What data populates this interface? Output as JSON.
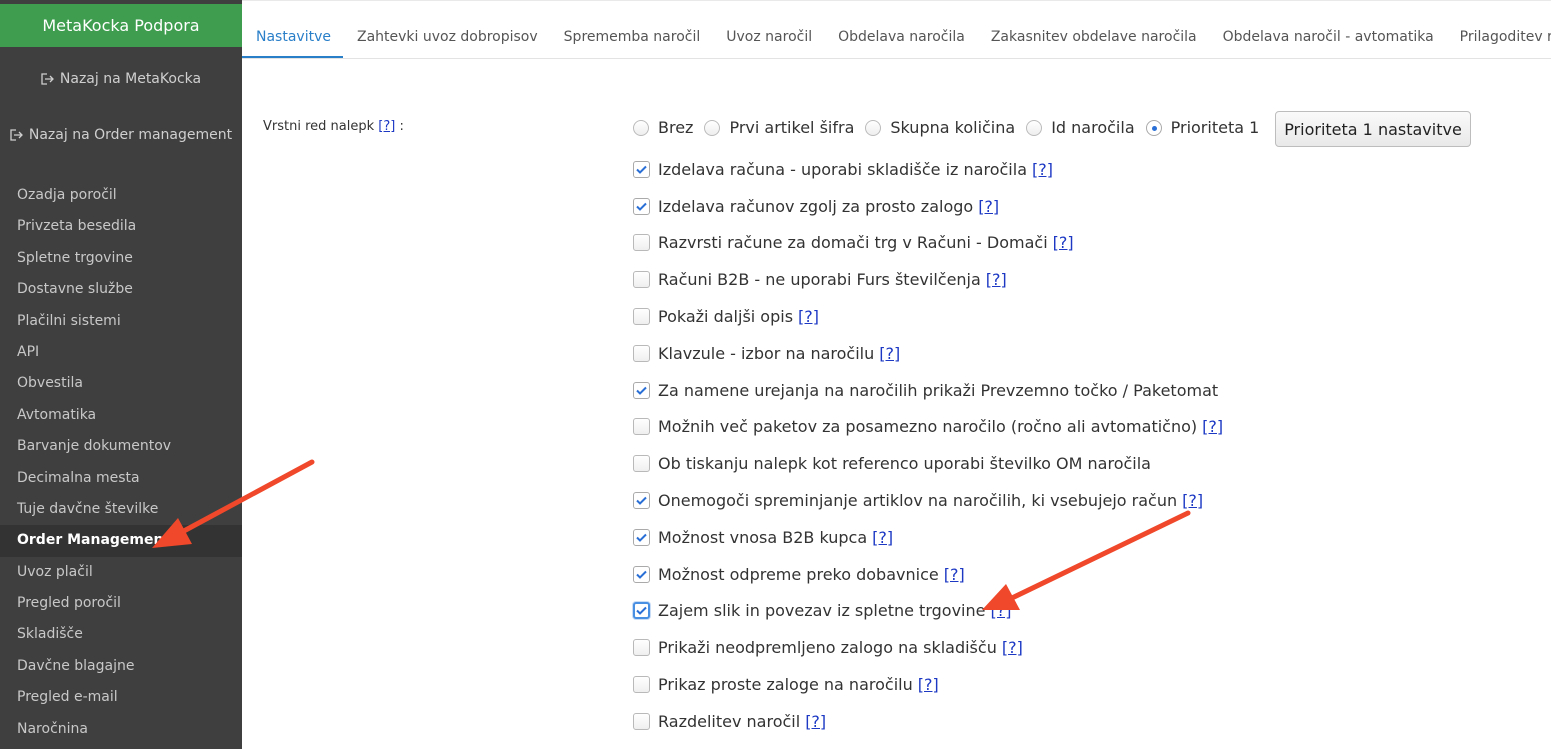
{
  "sidebar": {
    "brand": "MetaKocka Podpora",
    "back_links": [
      "Nazaj na MetaKocka",
      "Nazaj na Order management"
    ],
    "items": [
      {
        "label": "Ozadja poročil",
        "active": false
      },
      {
        "label": "Privzeta besedila",
        "active": false
      },
      {
        "label": "Spletne trgovine",
        "active": false
      },
      {
        "label": "Dostavne službe",
        "active": false
      },
      {
        "label": "Plačilni sistemi",
        "active": false
      },
      {
        "label": "API",
        "active": false
      },
      {
        "label": "Obvestila",
        "active": false
      },
      {
        "label": "Avtomatika",
        "active": false
      },
      {
        "label": "Barvanje dokumentov",
        "active": false
      },
      {
        "label": "Decimalna mesta",
        "active": false
      },
      {
        "label": "Tuje davčne številke",
        "active": false
      },
      {
        "label": "Order Management",
        "active": true
      },
      {
        "label": "Uvoz plačil",
        "active": false
      },
      {
        "label": "Pregled poročil",
        "active": false
      },
      {
        "label": "Skladišče",
        "active": false
      },
      {
        "label": "Davčne blagajne",
        "active": false
      },
      {
        "label": "Pregled e-mail",
        "active": false
      },
      {
        "label": "Naročnina",
        "active": false
      }
    ]
  },
  "tabs": [
    {
      "label": "Nastavitve",
      "active": true
    },
    {
      "label": "Zahtevki uvoz dobropisov",
      "active": false
    },
    {
      "label": "Sprememba naročil",
      "active": false
    },
    {
      "label": "Uvoz naročil",
      "active": false
    },
    {
      "label": "Obdelava naročila",
      "active": false
    },
    {
      "label": "Zakasnitev obdelave naročila",
      "active": false
    },
    {
      "label": "Obdelava naročil - avtomatika",
      "active": false
    },
    {
      "label": "Prilagoditev računa",
      "active": false
    }
  ],
  "settings": {
    "sticker_order_label": "Vrstni red nalepk",
    "sticker_order_suffix": " :",
    "help_text": "[?]",
    "radio_options": [
      {
        "label": "Brez",
        "selected": false
      },
      {
        "label": "Prvi artikel šifra",
        "selected": false
      },
      {
        "label": "Skupna količina",
        "selected": false
      },
      {
        "label": "Id naročila",
        "selected": false
      },
      {
        "label": "Prioriteta 1",
        "selected": true
      }
    ],
    "priority_button": "Prioriteta 1 nastavitve",
    "checkboxes": [
      {
        "label": "Izdelava računa - uporabi skladišče iz naročila",
        "checked": true,
        "help": true,
        "focused": false
      },
      {
        "label": "Izdelava računov zgolj za prosto zalogo",
        "checked": true,
        "help": true,
        "focused": false
      },
      {
        "label": "Razvrsti račune za domači trg v Računi - Domači",
        "checked": false,
        "help": true,
        "focused": false
      },
      {
        "label": "Računi B2B - ne uporabi Furs števil­čenja",
        "checked": false,
        "help": true,
        "focused": false
      },
      {
        "label": "Pokaži daljši opis",
        "checked": false,
        "help": true,
        "focused": false
      },
      {
        "label": "Klavzule - izbor na naročilu",
        "checked": false,
        "help": true,
        "focused": false
      },
      {
        "label": "Za namene urejanja na naročilih prikaži Prevzemno točko / Paketomat",
        "checked": true,
        "help": false,
        "focused": false
      },
      {
        "label": "Možnih več paketov za posamezno naročilo (ročno ali avtomatično)",
        "checked": false,
        "help": true,
        "focused": false
      },
      {
        "label": "Ob tiskanju nalepk kot referenco uporabi številko OM naročila",
        "checked": false,
        "help": false,
        "focused": false
      },
      {
        "label": "Onemogoči spreminjanje artiklov na naročilih, ki vsebujejo račun",
        "checked": true,
        "help": true,
        "focused": false
      },
      {
        "label": "Možnost vnosa B2B kupca",
        "checked": true,
        "help": true,
        "focused": false
      },
      {
        "label": "Možnost odpreme preko dobavnice",
        "checked": true,
        "help": true,
        "focused": false
      },
      {
        "label": "Zajem slik in povezav iz spletne trgovine",
        "checked": true,
        "help": true,
        "focused": true
      },
      {
        "label": "Prikaži neodpremljeno zalogo na skladišču",
        "checked": false,
        "help": true,
        "focused": false
      },
      {
        "label": "Prikaz proste zaloge na naročilu",
        "checked": false,
        "help": true,
        "focused": false
      },
      {
        "label": "Razdelitev naročil",
        "checked": false,
        "help": true,
        "focused": false
      }
    ]
  },
  "colors": {
    "brand_green": "#3e9d4f",
    "sidebar_bg": "#3f3f3f",
    "tab_active": "#2a7fc9",
    "annotation_arrow": "#f0482a",
    "checkbox_tick": "#2a6fd6"
  },
  "icons": {
    "back_link": "sign-out-icon",
    "checkmark": "checkmark-icon"
  }
}
